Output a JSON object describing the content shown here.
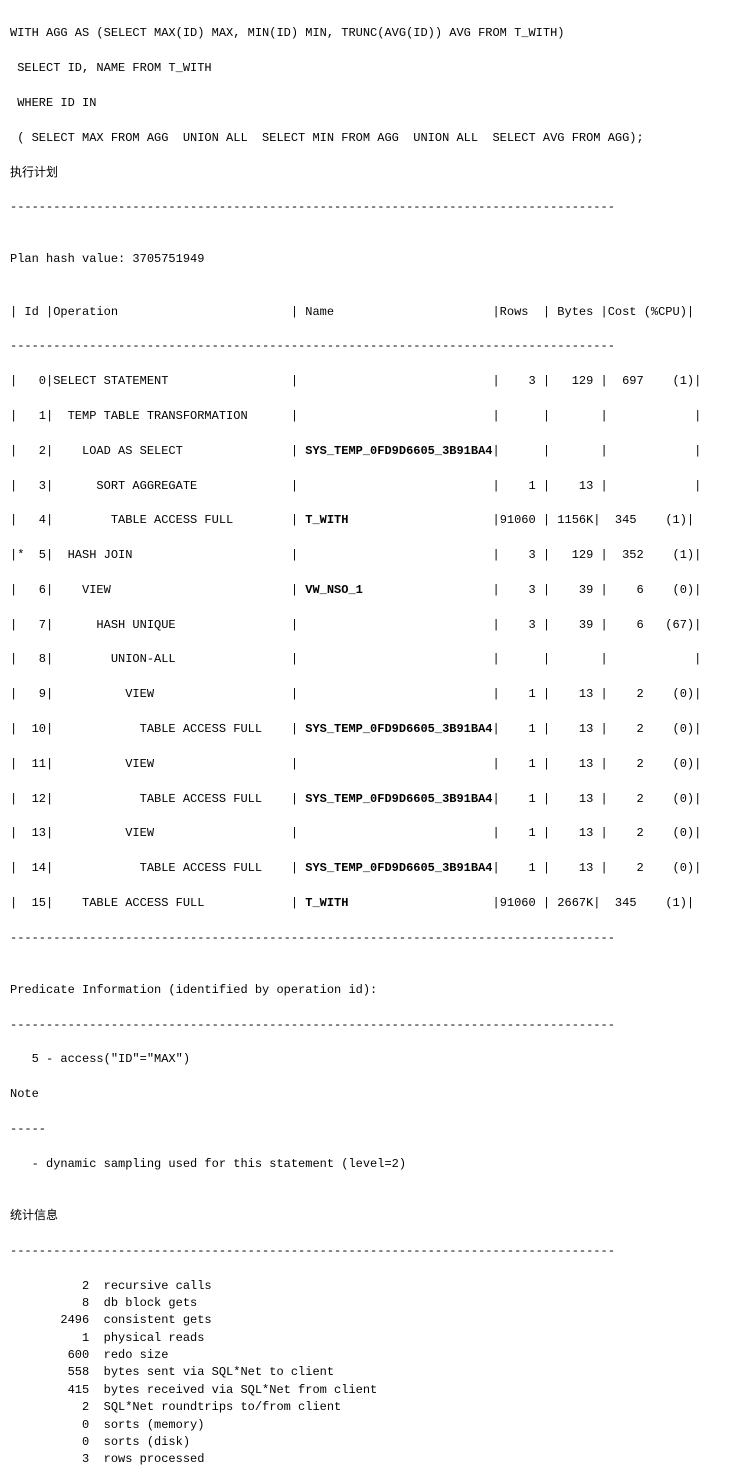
{
  "sql_block": {
    "line1": "WITH AGG AS (SELECT MAX(ID) MAX, MIN(ID) MIN, TRUNC(AVG(ID)) AVG FROM T_WITH)",
    "line2": " SELECT ID, NAME FROM T_WITH",
    "line3": " WHERE ID IN",
    "line4": " ( SELECT MAX FROM AGG  UNION ALL  SELECT MIN FROM AGG  UNION ALL  SELECT AVG FROM AGG);",
    "line5": "执行计划"
  },
  "plan_header": {
    "hash_label": "Plan hash value: 3705751949"
  },
  "table_header": "| Id |Operation                        | Name                      |Rows  | Bytes |Cost (%CPU)|",
  "divider_long": "------------------------------------------------------------------------------------",
  "rows": [
    "|   0|SELECT STATEMENT                 |                           |    3 |   129 |  697    (1)|",
    "|   1|  TEMP TABLE TRANSFORMATION      |                           |      |       |            |",
    "|   2|    LOAD AS SELECT               | SYS_TEMP_0FD9D6605_3B91BA4|      |       |            |",
    "|   3|      SORT AGGREGATE             |                           |    1 |    13 |            |",
    "|   4|        TABLE ACCESS FULL        | T_WITH                    |91060 | 1156K|  345    (1)|",
    "|*  5|  HASH JOIN                      |                           |    3 |   129 |  352    (1)|",
    "|   6|    VIEW                         | VW_NSO_1                  |    3 |    39 |    6    (0)|",
    "|   7|      HASH UNIQUE                |                           |    3 |    39 |    6   (67)|",
    "|   8|        UNION-ALL                |                           |      |       |            |",
    "|   9|          VIEW                   |                           |    1 |    13 |    2    (0)|",
    "|  10|            TABLE ACCESS FULL    | SYS_TEMP_0FD9D6605_3B91BA4|    1 |    13 |    2    (0)|",
    "|  11|          VIEW                   |                           |    1 |    13 |    2    (0)|",
    "|  12|            TABLE ACCESS FULL    | SYS_TEMP_0FD9D6605_3B91BA4|    1 |    13 |    2    (0)|",
    "|  13|          VIEW                   |                           |    1 |    13 |    2    (0)|",
    "|  14|            TABLE ACCESS FULL    | SYS_TEMP_0FD9D6605_3B91BA4|    1 |    13 |    2    (0)|",
    "|  15|    TABLE ACCESS FULL            | T_WITH                    |91060 | 2667K|  345    (1)|"
  ],
  "predicate_section": {
    "header": "Predicate Information (identified by operation id):",
    "divider": "------------------------------------------------------------------------------------",
    "line1": "   5 - access(\"ID\"=\"MAX\")"
  },
  "note_section": {
    "header": "Note",
    "divider": "-----",
    "line1": "   - dynamic sampling used for this statement (level=2)"
  },
  "stats_section": {
    "header": "统计信息",
    "divider": "------------------------------------------------------------------------------------",
    "rows": [
      "          2  recursive calls",
      "          8  db block gets",
      "       2496  consistent gets",
      "          1  physical reads",
      "        600  redo size",
      "        558  bytes sent via SQL*Net to client",
      "        415  bytes received via SQL*Net from client",
      "          2  SQL*Net roundtrips to/from client",
      "          0  sorts (memory)",
      "          0  sorts (disk)",
      "          3  rows processed"
    ]
  }
}
